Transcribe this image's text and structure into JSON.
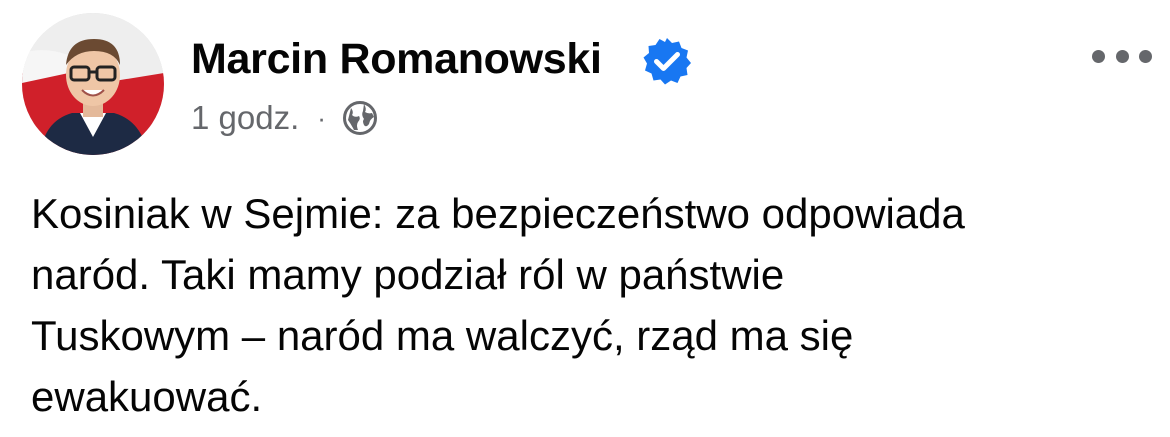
{
  "post": {
    "author": {
      "name": "Marcin Romanowski",
      "verified": true,
      "avatar_icon": "profile-photo"
    },
    "meta": {
      "time": "1 godz.",
      "separator": "·",
      "audience_icon": "globe-icon"
    },
    "more_icon": "more-horizontal-icon",
    "text": "Kosiniak w Sejmie: za bezpieczeństwo odpowiada\nnaród. Taki mamy podział ról w państwie\nTuskowym – naród ma walczyć, rząd ma się\newakuować."
  },
  "colors": {
    "text": "#050505",
    "secondary": "#65676b",
    "verified_badge": "#1877f2",
    "background": "#ffffff"
  }
}
